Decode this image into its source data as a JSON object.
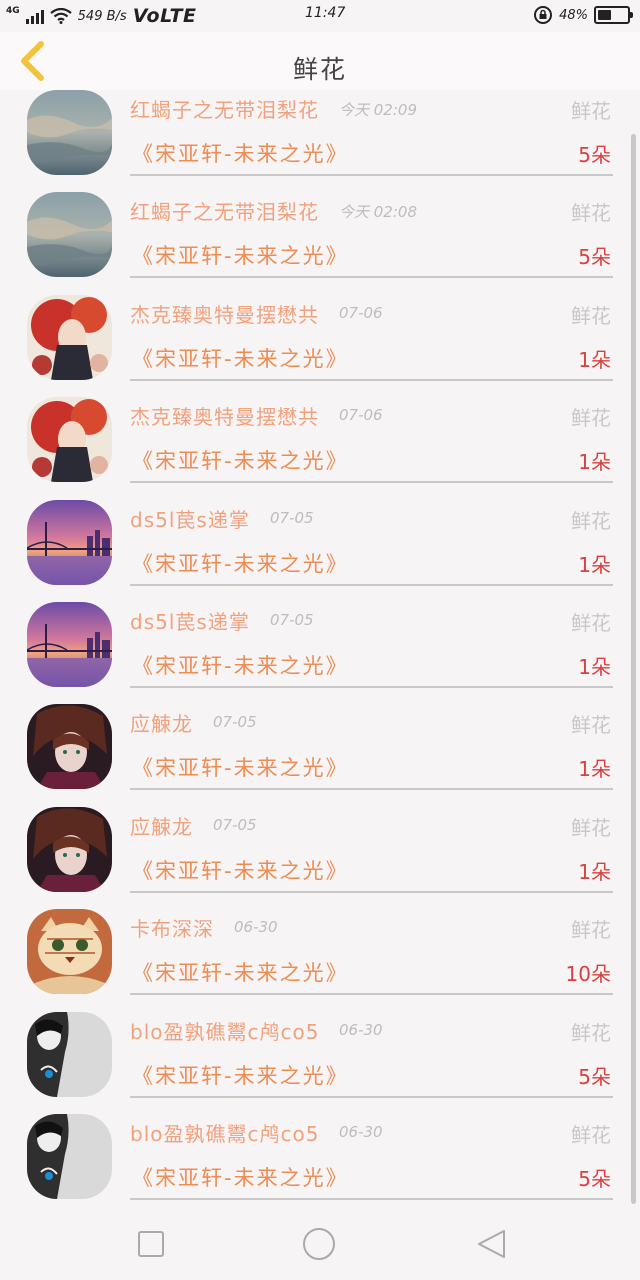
{
  "status_bar": {
    "net_type": "4G",
    "net_speed": "549 B/s",
    "volte": "VoLTE",
    "time": "11:47",
    "battery": "48%",
    "battery_level": 0.48
  },
  "header": {
    "title": "鲜花",
    "back_icon": "chevron-left-icon"
  },
  "list": {
    "items": [
      {
        "sender": "红蝎子之无带泪梨花",
        "time": "今天 02:09",
        "type": "鲜花",
        "gift": "《宋亚轩-未来之光》",
        "count": "5朵",
        "avatar": "sky-clouds"
      },
      {
        "sender": "红蝎子之无带泪梨花",
        "time": "今天 02:08",
        "type": "鲜花",
        "gift": "《宋亚轩-未来之光》",
        "count": "5朵",
        "avatar": "sky-clouds"
      },
      {
        "sender": "杰克臻奥特曼摆懋共",
        "time": "07-06",
        "type": "鲜花",
        "gift": "《宋亚轩-未来之光》",
        "count": "1朵",
        "avatar": "red-hair-anime"
      },
      {
        "sender": "杰克臻奥特曼摆懋共",
        "time": "07-06",
        "type": "鲜花",
        "gift": "《宋亚轩-未来之光》",
        "count": "1朵",
        "avatar": "red-hair-anime"
      },
      {
        "sender": "ds5l苠s递掌",
        "time": "07-05",
        "type": "鲜花",
        "gift": "《宋亚轩-未来之光》",
        "count": "1朵",
        "avatar": "bridge-sunset"
      },
      {
        "sender": "ds5l苠s递掌",
        "time": "07-05",
        "type": "鲜花",
        "gift": "《宋亚轩-未来之光》",
        "count": "1朵",
        "avatar": "bridge-sunset"
      },
      {
        "sender": "应觫龙",
        "time": "07-05",
        "type": "鲜花",
        "gift": "《宋亚轩-未来之光》",
        "count": "1朵",
        "avatar": "dark-hair-anime"
      },
      {
        "sender": "应觫龙",
        "time": "07-05",
        "type": "鲜花",
        "gift": "《宋亚轩-未来之光》",
        "count": "1朵",
        "avatar": "dark-hair-anime"
      },
      {
        "sender": "卡布深深",
        "time": "06-30",
        "type": "鲜花",
        "gift": "《宋亚轩-未来之光》",
        "count": "10朵",
        "avatar": "cat-drawing"
      },
      {
        "sender": "blo盈孰礁鬻c鸬co5",
        "time": "06-30",
        "type": "鲜花",
        "gift": "《宋亚轩-未来之光》",
        "count": "5朵",
        "avatar": "boy-sketch"
      },
      {
        "sender": "blo盈孰礁鬻c鸬co5",
        "time": "06-30",
        "type": "鲜花",
        "gift": "《宋亚轩-未来之光》",
        "count": "5朵",
        "avatar": "boy-sketch"
      }
    ]
  },
  "nav_bar": {
    "recents_icon": "square-icon",
    "home_icon": "circle-icon",
    "back_icon": "triangle-back-icon"
  },
  "colors": {
    "sender": "#f1a27d",
    "gift": "#ef8c52",
    "count": "#d8413f",
    "muted": "#c8c8c8",
    "back_chevron": "#f0c43c"
  }
}
